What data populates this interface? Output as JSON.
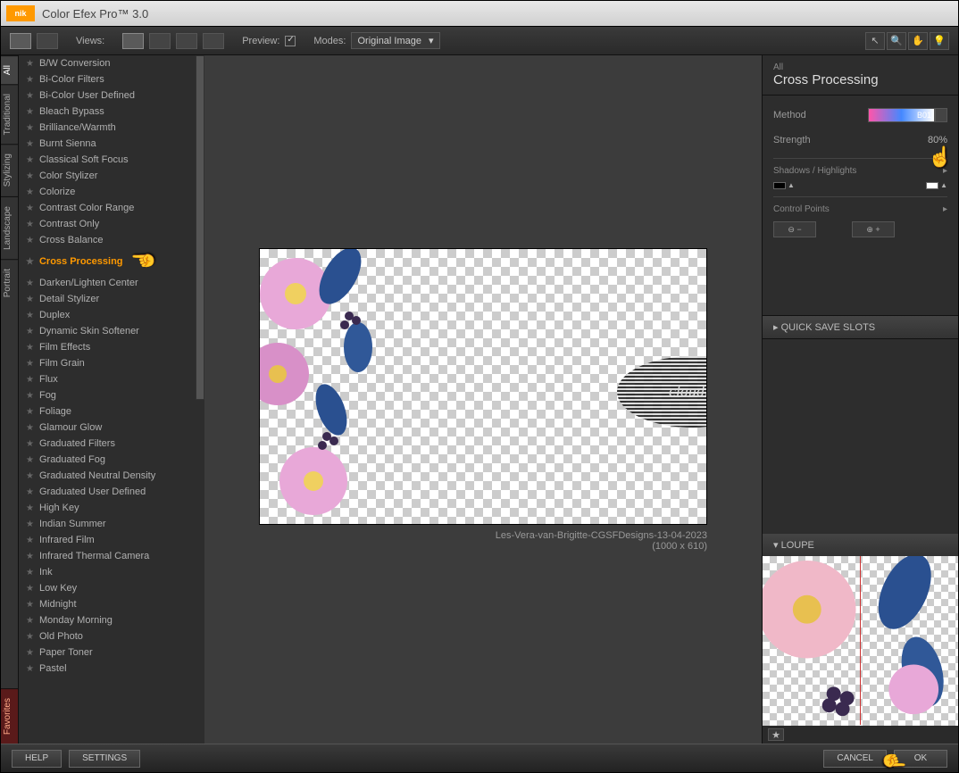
{
  "title": "Color Efex Pro™ 3.0",
  "logo": "nik",
  "toolbar": {
    "views_label": "Views:",
    "preview_label": "Preview:",
    "modes_label": "Modes:",
    "mode_value": "Original Image"
  },
  "vtabs": [
    "All",
    "Traditional",
    "Stylizing",
    "Landscape",
    "Portrait"
  ],
  "vtabs_fav": "Favorites",
  "filters": [
    "B/W Conversion",
    "Bi-Color Filters",
    "Bi-Color User Defined",
    "Bleach Bypass",
    "Brilliance/Warmth",
    "Burnt Sienna",
    "Classical Soft Focus",
    "Color Stylizer",
    "Colorize",
    "Contrast Color Range",
    "Contrast Only",
    "Cross Balance",
    "Cross Processing",
    "Darken/Lighten Center",
    "Detail Stylizer",
    "Duplex",
    "Dynamic Skin Softener",
    "Film Effects",
    "Film Grain",
    "Flux",
    "Fog",
    "Foliage",
    "Glamour Glow",
    "Graduated Filters",
    "Graduated Fog",
    "Graduated Neutral Density",
    "Graduated User Defined",
    "High Key",
    "Indian Summer",
    "Infrared Film",
    "Infrared Thermal Camera",
    "Ink",
    "Low Key",
    "Midnight",
    "Monday Morning",
    "Old Photo",
    "Paper Toner",
    "Pastel"
  ],
  "selected_filter_index": 12,
  "canvas": {
    "filename": "Les-Vera-van-Brigitte-CGSFDesigns-13-04-2023",
    "dimensions": "(1000 x 610)"
  },
  "right": {
    "all": "All",
    "title": "Cross Processing",
    "method_label": "Method",
    "method_value": "B01",
    "strength_label": "Strength",
    "strength_value": "80%",
    "shadows_label": "Shadows / Highlights",
    "control_points_label": "Control Points",
    "quicksave": "QUICK SAVE SLOTS",
    "loupe": "LOUPE"
  },
  "footer": {
    "help": "HELP",
    "settings": "SETTINGS",
    "cancel": "CANCEL",
    "ok": "OK"
  }
}
